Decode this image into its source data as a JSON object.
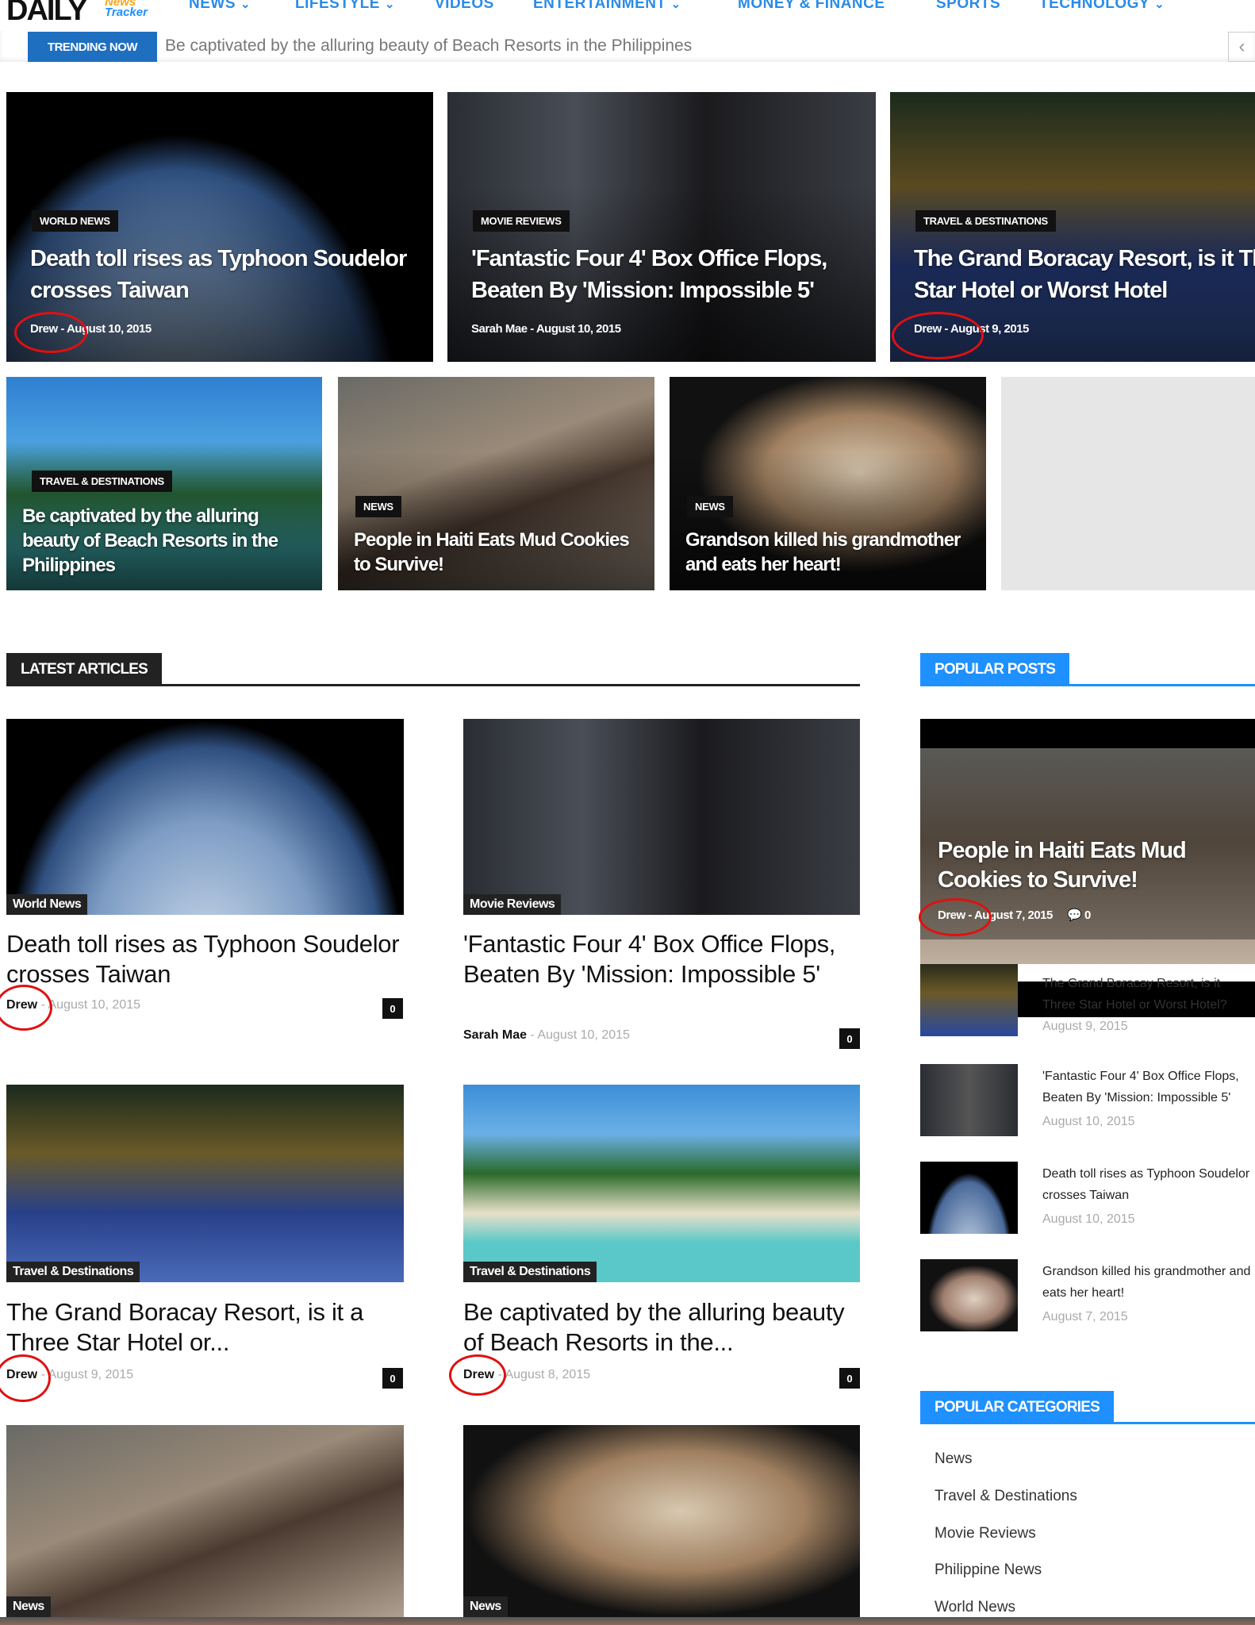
{
  "header": {
    "logo": "DAILY",
    "logo_sub_top": "News",
    "logo_sub_bottom": "Tracker",
    "nav": [
      {
        "label": "NEWS",
        "dropdown": true
      },
      {
        "label": "LIFESTYLE",
        "dropdown": true
      },
      {
        "label": "VIDEOS",
        "dropdown": false
      },
      {
        "label": "ENTERTAINMENT",
        "dropdown": true
      },
      {
        "label": "MONEY & FINANCE",
        "dropdown": false
      },
      {
        "label": "SPORTS",
        "dropdown": false
      },
      {
        "label": "TECHNOLOGY",
        "dropdown": true
      }
    ]
  },
  "trending": {
    "label": "TRENDING NOW",
    "text": "Be captivated by the alluring beauty of Beach Resorts in the Philippines",
    "prev_icon": "chevron-left-icon"
  },
  "featured": [
    {
      "category": "WORLD NEWS",
      "title": "Death toll rises as Typhoon Soudelor crosses Taiwan",
      "author": "Drew",
      "date": "August 10, 2015"
    },
    {
      "category": "MOVIE REVIEWS",
      "title": "'Fantastic Four 4' Box Office Flops, Beaten By 'Mission: Impossible 5'",
      "author": "Sarah Mae",
      "date": "August 10, 2015"
    },
    {
      "category": "TRAVEL & DESTINATIONS",
      "title": "The Grand Boracay Resort, is it Three Star Hotel or Worst Hotel",
      "author": "Drew",
      "date": "August 9, 2015"
    },
    {
      "category": "TRAVEL & DESTINATIONS",
      "title": "Be captivated by the alluring beauty of Beach Resorts in the Philippines"
    },
    {
      "category": "NEWS",
      "title": "People in Haiti Eats Mud Cookies to Survive!"
    },
    {
      "category": "NEWS",
      "title": "Grandson killed his grandmother and eats her heart!"
    }
  ],
  "latest": {
    "heading": "LATEST ARTICLES",
    "articles": [
      {
        "category": "World News",
        "title": "Death toll rises as Typhoon Soudelor crosses Taiwan",
        "author": "Drew",
        "date": "August 10, 2015",
        "comments": "0"
      },
      {
        "category": "Movie Reviews",
        "title": "'Fantastic Four 4' Box Office Flops, Beaten By 'Mission: Impossible 5'",
        "author": "Sarah Mae",
        "date": "August 10, 2015",
        "comments": "0"
      },
      {
        "category": "Travel & Destinations",
        "title": "The Grand Boracay Resort, is it a Three Star Hotel or...",
        "author": "Drew",
        "date": "August 9, 2015",
        "comments": "0"
      },
      {
        "category": "Travel & Destinations",
        "title": "Be captivated by the alluring beauty of Beach Resorts in the...",
        "author": "Drew",
        "date": "August 8, 2015",
        "comments": "0"
      },
      {
        "category": "News"
      },
      {
        "category": "News"
      }
    ]
  },
  "popular": {
    "heading": "POPULAR POSTS",
    "top": {
      "title": "People in Haiti Eats Mud Cookies to Survive!",
      "author": "Drew",
      "date": "August 7, 2015",
      "comments": "0"
    },
    "items": [
      {
        "title": "The Grand Boracay Resort, is it Three Star Hotel or Worst Hotel?",
        "date": "August 9, 2015"
      },
      {
        "title": "'Fantastic Four 4' Box Office Flops, Beaten By 'Mission: Impossible 5'",
        "date": "August 10, 2015"
      },
      {
        "title": "Death toll rises as Typhoon Soudelor crosses Taiwan",
        "date": "August 10, 2015"
      },
      {
        "title": "Grandson killed his grandmother and eats her heart!",
        "date": "August 7, 2015"
      }
    ]
  },
  "categories": {
    "heading": "POPULAR CATEGORIES",
    "items": [
      "News",
      "Travel & Destinations",
      "Movie Reviews",
      "Philippine News",
      "World News"
    ]
  },
  "colors": {
    "accent": "#1e90ff",
    "nav": "#2a8be8",
    "trending": "#1f6fc1",
    "annotation": "#e01010"
  }
}
